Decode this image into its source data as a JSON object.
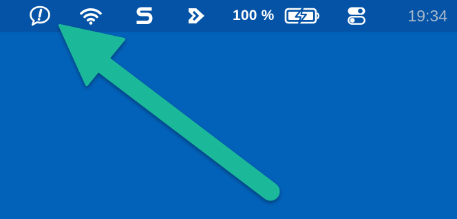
{
  "menubar": {
    "items": [
      {
        "name": "feedback-icon"
      },
      {
        "name": "wifi-icon"
      },
      {
        "name": "app-s-icon"
      },
      {
        "name": "app-forward-icon"
      },
      {
        "name": "battery-icon"
      },
      {
        "name": "control-center-icon"
      }
    ],
    "battery_percent": "100 %",
    "clock": "19:34"
  },
  "annotation": {
    "name": "pointer-arrow",
    "color": "#1bb89a"
  },
  "colors": {
    "menubar_bg": "#0453a6",
    "desktop_bg": "#0261b9",
    "icon": "#ffffff",
    "clock_text": "#a8b8cc"
  }
}
